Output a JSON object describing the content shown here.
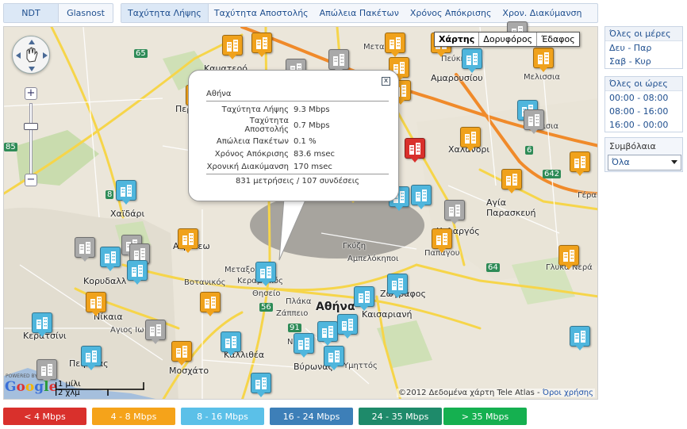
{
  "tabs_left": [
    "NDT",
    "Glasnost"
  ],
  "tabs_main": [
    "Ταχύτητα Λήψης",
    "Ταχύτητα Αποστολής",
    "Απώλεια Πακέτων",
    "Χρόνος Απόκρισης",
    "Χρον. Διακύμανση"
  ],
  "map_types": [
    "Χάρτης",
    "Δορυφόρος",
    "Έδαφος"
  ],
  "popup": {
    "title": "Αθήνα",
    "rows": [
      {
        "label": "Ταχύτητα Λήψης",
        "value": "9.3 Mbps"
      },
      {
        "label": "Ταχύτητα Αποστολής",
        "value": "0.7 Mbps"
      },
      {
        "label": "Απώλεια Πακέτων",
        "value": "0.1 %"
      },
      {
        "label": "Χρόνος Απόκρισης",
        "value": "83.6 msec"
      },
      {
        "label": "Χρονική Διακύμανση",
        "value": "170 msec"
      }
    ],
    "summary": "831 μετρήσεις / 107 συνδέσεις",
    "close": "x"
  },
  "map_labels": {
    "athina": "Αθήνα",
    "kamatero": "Καματερό",
    "peristeri": "Περ",
    "chaidari": "Χαϊδάρι",
    "korydallos": "Κορυδαλλ",
    "aigaleo": "Αιγάλεω",
    "nikaia": "Νίκαια",
    "agios_ioannis": "Αγιος Ιω",
    "keratsini": "Κερατσίνι",
    "peiraias": "Πειραιάς",
    "moschato": "Μοσχάτο",
    "kallithea": "Καλλιθέα",
    "vyronas": "Βύρωνας",
    "ymittos": "Υμηττός",
    "kaisariani": "Καισαριανή",
    "zografou": "Ζωγράφος",
    "cholargos": "Χολαργός",
    "papagou": "Παπάγου",
    "agia_paraskevi": "Αγία Παρασκευή",
    "marousi": "Αμαρουσίου",
    "chalandri": "Χαλανδρι",
    "glyka_nera": "Γλυκά Νερά",
    "gerakas": "Γέρακ",
    "peuki": "Πεύκη",
    "melissia": "Μελισσια",
    "metamorfosi": "Μετα",
    "psychiko": "Ψυχικό",
    "goudi": "Γκύζη",
    "ampelokipoi": "Αμπελόκηποι",
    "thiseio": "Θησείο",
    "plaka": "Πλάκα",
    "zappeio": "Ζάππειο",
    "keramikos": "Κεραμεικός",
    "votanikos": "Βοτανικός",
    "metaxourgeio": "Μεταξουργ",
    "neos_kosmos": "Νέος",
    "d_fyli": "Λεωφόρος Φυλής",
    "ilissia": "Ηλισια",
    "attiki_odos": "Αττική Οδός",
    "vrilissia": "Βριλησσια"
  },
  "road_numbers": [
    "65",
    "85",
    "8",
    "6",
    "642",
    "64",
    "56",
    "91"
  ],
  "attribution": "©2012 Δεδομένα χάρτη Tele Atlas -",
  "attribution_link": "Όροι χρήσης",
  "google": "Google",
  "powered": "POWERED BY",
  "scale": {
    "top": "1 μίλι",
    "bottom": "2 χλμ"
  },
  "days": {
    "header": "Όλες οι μέρες",
    "items": [
      "Δευ - Παρ",
      "Σαβ - Κυρ"
    ]
  },
  "hours": {
    "header": "Όλες οι ώρες",
    "items": [
      "00:00 - 08:00",
      "08:00 - 16:00",
      "16:00 - 00:00"
    ]
  },
  "contracts": {
    "label": "Συμβόλαια",
    "selected": "Όλα"
  },
  "legend": [
    {
      "label": "< 4 Mbps",
      "color": "#d9302c",
      "text": "#ffffff"
    },
    {
      "label": "4 - 8 Mbps",
      "color": "#f5a31a",
      "text": "#ffffff"
    },
    {
      "label": "8 - 16 Mbps",
      "color": "#5bc0e8",
      "text": "#ffffff"
    },
    {
      "label": "16 - 24 Mbps",
      "color": "#3d7fb8",
      "text": "#ffffff"
    },
    {
      "label": "24 - 35 Mbps",
      "color": "#1e8a6a",
      "text": "#ffffff"
    },
    {
      "label": "> 35 Mbps",
      "color": "#15b050",
      "text": "#ffffff"
    }
  ],
  "marker_colors": {
    "orange": "#f0a21c",
    "cyan": "#4fb6dd",
    "gray": "#a9a9a9",
    "red": "#d9302c"
  }
}
